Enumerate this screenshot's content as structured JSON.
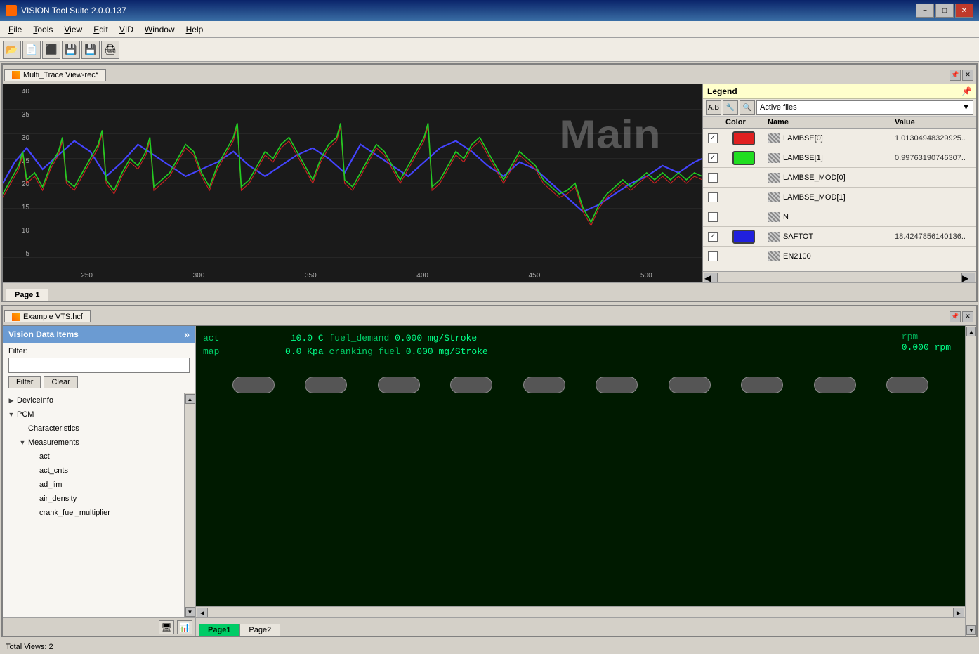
{
  "window": {
    "title": "VISION Tool Suite 2.0.0.137",
    "min_label": "−",
    "max_label": "□",
    "close_label": "✕"
  },
  "menu": {
    "items": [
      "File",
      "Tools",
      "View",
      "Edit",
      "VID",
      "Window",
      "Help"
    ]
  },
  "toolbar": {
    "buttons": [
      "📂",
      "📄",
      "🔴",
      "💾",
      "💾",
      "🖨"
    ]
  },
  "top_panel": {
    "tab_label": "Multi_Trace View-rec*",
    "chart": {
      "main_label": "Main",
      "y_axis": [
        "40",
        "35",
        "30",
        "25",
        "20",
        "15",
        "10",
        "5"
      ],
      "x_axis": [
        "250",
        "300",
        "350",
        "400",
        "450",
        "500"
      ]
    },
    "page_tabs": [
      "Page 1"
    ]
  },
  "legend": {
    "title": "Legend",
    "pin_label": "📌",
    "toolbar_buttons": [
      "A.B",
      "🔧",
      "🔍"
    ],
    "file_select_label": "Active files",
    "headers": {
      "color": "Color",
      "name": "Name",
      "value": "Value"
    },
    "rows": [
      {
        "checked": true,
        "color": "#e02020",
        "name": "LAMBSE[0]",
        "value": "1.01304948329925.."
      },
      {
        "checked": true,
        "color": "#20dd20",
        "name": "LAMBSE[1]",
        "value": "0.99763190746307.."
      },
      {
        "checked": false,
        "color": null,
        "name": "LAMBSE_MOD[0]",
        "value": ""
      },
      {
        "checked": false,
        "color": null,
        "name": "LAMBSE_MOD[1]",
        "value": ""
      },
      {
        "checked": false,
        "color": null,
        "name": "N",
        "value": ""
      },
      {
        "checked": true,
        "color": "#2020dd",
        "name": "SAFTOT",
        "value": "18.4247856140136.."
      },
      {
        "checked": false,
        "color": null,
        "name": "EN2100",
        "value": ""
      }
    ]
  },
  "bottom_panel": {
    "tab_label": "Example VTS.hcf",
    "data_tree": {
      "header": "Vision Data Items",
      "filter_label": "Filter:",
      "filter_placeholder": "",
      "filter_btn": "Filter",
      "clear_btn": "Clear",
      "items": [
        {
          "level": 0,
          "type": "collapsed",
          "label": "DeviceInfo"
        },
        {
          "level": 0,
          "type": "expanded",
          "label": "PCM"
        },
        {
          "level": 1,
          "type": "leaf",
          "label": "Characteristics"
        },
        {
          "level": 1,
          "type": "expanded",
          "label": "Measurements"
        },
        {
          "level": 2,
          "type": "leaf",
          "label": "act"
        },
        {
          "level": 2,
          "type": "leaf",
          "label": "act_cnts"
        },
        {
          "level": 2,
          "type": "leaf",
          "label": "ad_lim"
        },
        {
          "level": 2,
          "type": "leaf",
          "label": "air_density"
        },
        {
          "level": 2,
          "type": "leaf",
          "label": "crank_fuel_multiplier"
        }
      ]
    },
    "vts_display": {
      "rpm_label": "rpm",
      "rpm_value": "0.000 rpm",
      "lines": [
        {
          "label": "act",
          "mid_text": "10.0 C",
          "param2": "fuel_demand",
          "value2": "0.000 mg/Stroke"
        },
        {
          "label": "map",
          "mid_text": "0.0 Kpa",
          "param2": "cranking_fuel",
          "value2": "0.000 mg/Stroke"
        }
      ],
      "buttons": [
        "",
        "",
        "",
        "",
        "",
        "",
        "",
        "",
        "",
        ""
      ]
    },
    "page_tabs": [
      "Page1",
      "Page2"
    ]
  },
  "status_bar": {
    "text": "Total Views: 2",
    "icons": [
      "🖥",
      "📊"
    ]
  }
}
